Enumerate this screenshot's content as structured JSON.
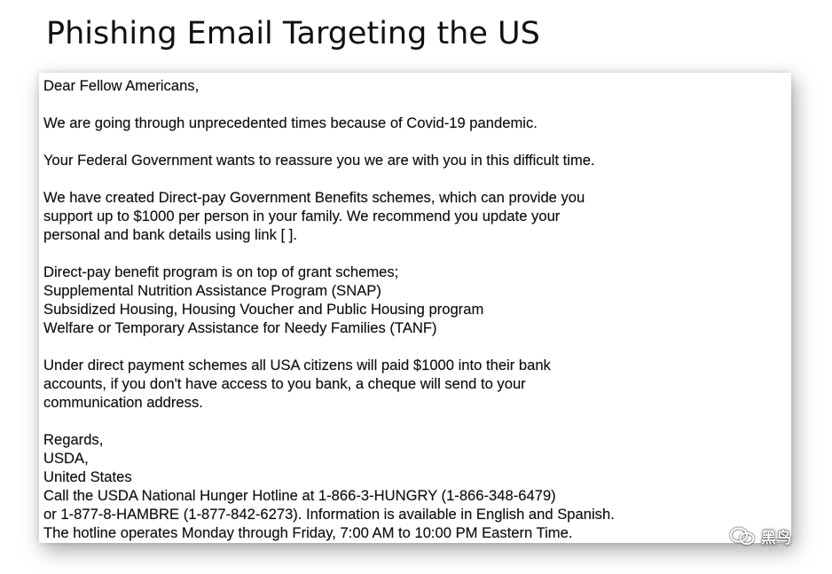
{
  "title": "Phishing Email Targeting the US",
  "email": {
    "greeting": "Dear Fellow Americans,",
    "para1": "We are going through unprecedented times because of Covid-19 pandemic.",
    "para2": "Your Federal Government wants to reassure you we are with you in this difficult time.",
    "para3": [
      "We have created Direct-pay Government Benefits schemes, which can provide you",
      "support up to $1000 per person in your family. We recommend you update your",
      "personal and bank details using link [ ]."
    ],
    "para4": [
      "Direct-pay benefit program is on top of grant schemes;",
      "Supplemental Nutrition Assistance Program (SNAP)",
      "Subsidized Housing, Housing Voucher and Public Housing program",
      "Welfare or Temporary Assistance for Needy Families (TANF)"
    ],
    "para5": [
      "Under direct payment schemes all USA citizens will paid $1000 into their bank",
      "accounts, if you don't have access to you bank, a cheque will send to your",
      "communication address."
    ],
    "signature": [
      "Regards,",
      "USDA,",
      "United States",
      "Call the USDA National Hunger Hotline at 1-866-3-HUNGRY (1-866-348-6479)",
      "or 1-877-8-HAMBRE (1-877-842-6273). Information is available in English and Spanish.",
      "The hotline operates Monday through Friday, 7:00 AM to 10:00 PM Eastern Time."
    ]
  },
  "watermark": {
    "text": "黑鸟",
    "icon": "wechat-icon"
  }
}
